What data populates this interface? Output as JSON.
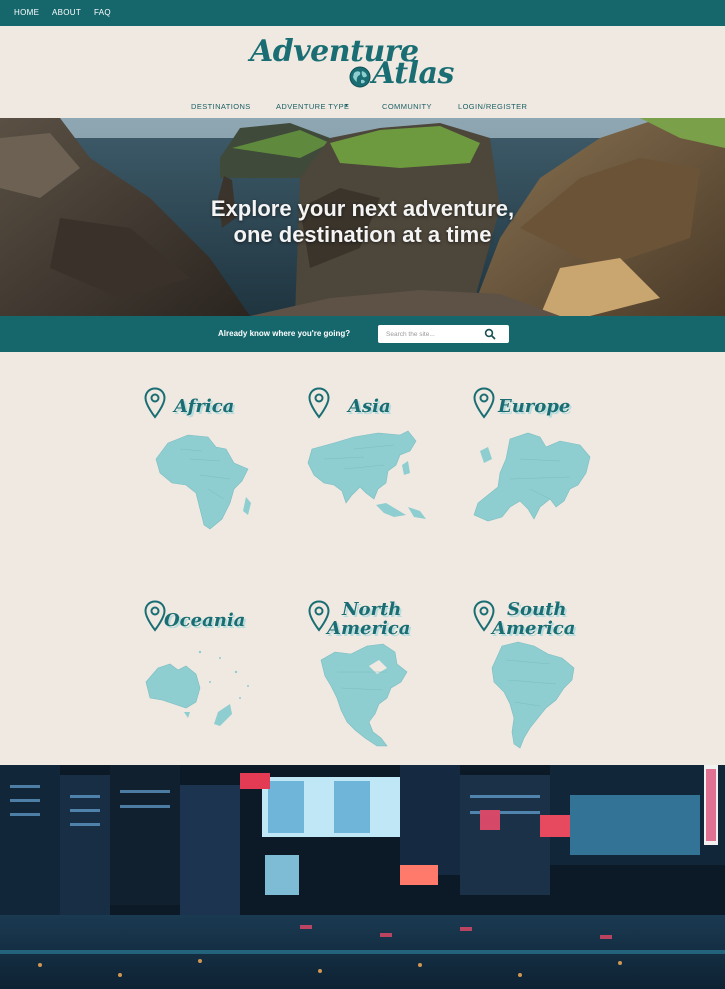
{
  "topnav": {
    "items": [
      "HOME",
      "ABOUT",
      "FAQ"
    ]
  },
  "logo": {
    "line1": "Adventure",
    "line2": "Atlas"
  },
  "mainnav": {
    "items": [
      "DESTINATIONS",
      "ADVENTURE TYPE",
      "COMMUNITY",
      "LOGIN/REGISTER"
    ],
    "dropdown_caret": "▾"
  },
  "hero": {
    "line1": "Explore your next adventure,",
    "line2": "one destination at a time"
  },
  "search": {
    "label": "Already know where you're going?",
    "placeholder": "Search the site..."
  },
  "regions": [
    {
      "name": "Africa",
      "map_icon": "africa-map"
    },
    {
      "name": "Asia",
      "map_icon": "asia-map"
    },
    {
      "name": "Europe",
      "map_icon": "europe-map"
    },
    {
      "name": "Oceania",
      "map_icon": "oceania-map"
    },
    {
      "name": "North America",
      "line1": "North",
      "line2": "America",
      "map_icon": "north-america-map"
    },
    {
      "name": "South America",
      "line1": "South",
      "line2": "America",
      "map_icon": "south-america-map"
    }
  ],
  "colors": {
    "brand_teal": "#16676c",
    "map_fill": "#8ecdd0",
    "background": "#efe9e2"
  }
}
